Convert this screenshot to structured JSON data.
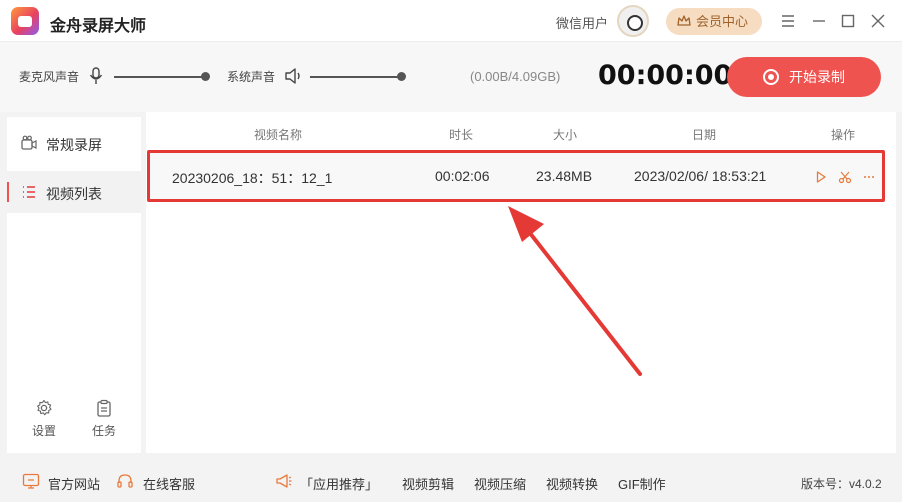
{
  "app": {
    "title": "金舟录屏大师"
  },
  "user": {
    "name": "微信用户",
    "vip_label": "会员中心"
  },
  "controls": {
    "mic_label": "麦克风声音",
    "system_label": "系统声音",
    "storage": "(0.00B/4.09GB)",
    "timer": "00:00:00",
    "record_label": "开始录制"
  },
  "sidebar": {
    "items": [
      {
        "label": "常规录屏",
        "icon": "video-camera-icon",
        "active": false
      },
      {
        "label": "视频列表",
        "icon": "list-icon",
        "active": true
      }
    ],
    "tools": [
      {
        "label": "设置",
        "icon": "gear-icon"
      },
      {
        "label": "任务",
        "icon": "clipboard-icon"
      }
    ]
  },
  "list": {
    "columns": [
      "视频名称",
      "时长",
      "大小",
      "日期",
      "操作"
    ],
    "rows": [
      {
        "name": "20230206_18：51：12_1",
        "duration": "00:02:06",
        "size": "23.48MB",
        "date": "2023/02/06/ 18:53:21"
      }
    ]
  },
  "footer": {
    "website": "官方网站",
    "support": "在线客服",
    "recommend": "「应用推荐」",
    "links": [
      "视频剪辑",
      "视频压缩",
      "视频转换",
      "GIF制作"
    ],
    "version": "版本号：v4.0.2"
  },
  "colors": {
    "accent": "#ef5350",
    "highlight": "#e53935",
    "vip_bg": "#f6dcc1"
  }
}
